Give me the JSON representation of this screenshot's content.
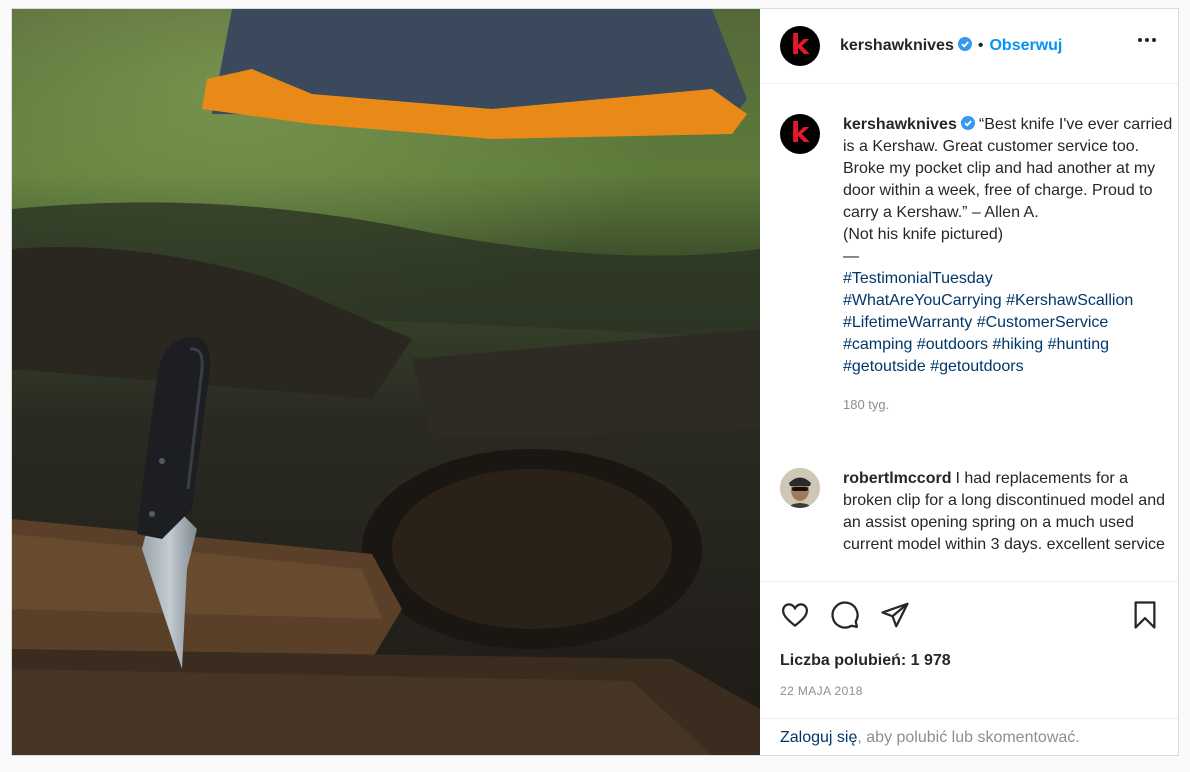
{
  "header": {
    "avatar_letter": "k",
    "username": "kershawknives",
    "separator": "•",
    "follow_label": "Obserwuj"
  },
  "caption": {
    "username": "kershawknives",
    "text": "“Best knife I've ever carried is a Kershaw. Great customer service too. Broke my pocket clip and had another at my door within a week, free of charge. Proud to carry a Kershaw.” – Allen A.",
    "note": "(Not his knife pictured)",
    "dash": "—",
    "hashtags": [
      "#TestimonialTuesday",
      "#WhatAreYouCarrying",
      "#KershawScallion",
      "#LifetimeWarranty",
      "#CustomerService",
      "#camping",
      "#outdoors",
      "#hiking",
      "#hunting",
      "#getoutside",
      "#getoutdoors"
    ],
    "time": "180 tyg."
  },
  "comment": {
    "username": "robertlmccord",
    "text": "I had replacements for a broken clip for a long discontinued model and an assist opening spring on a much used current model within 3 days. excellent service"
  },
  "actions": {
    "icons": [
      "heart-icon",
      "comment-icon",
      "share-icon",
      "bookmark-icon"
    ],
    "likes_label": "Liczba polubień: 1 978",
    "date": "22 MAJA 2018"
  },
  "login": {
    "link": "Zaloguj się",
    "rest": ", aby polubić lub skomentować."
  },
  "colors": {
    "link_blue": "#0095f6",
    "hashtag": "#00376b",
    "brand_red": "#e4182b",
    "verified": "#3897f0"
  }
}
